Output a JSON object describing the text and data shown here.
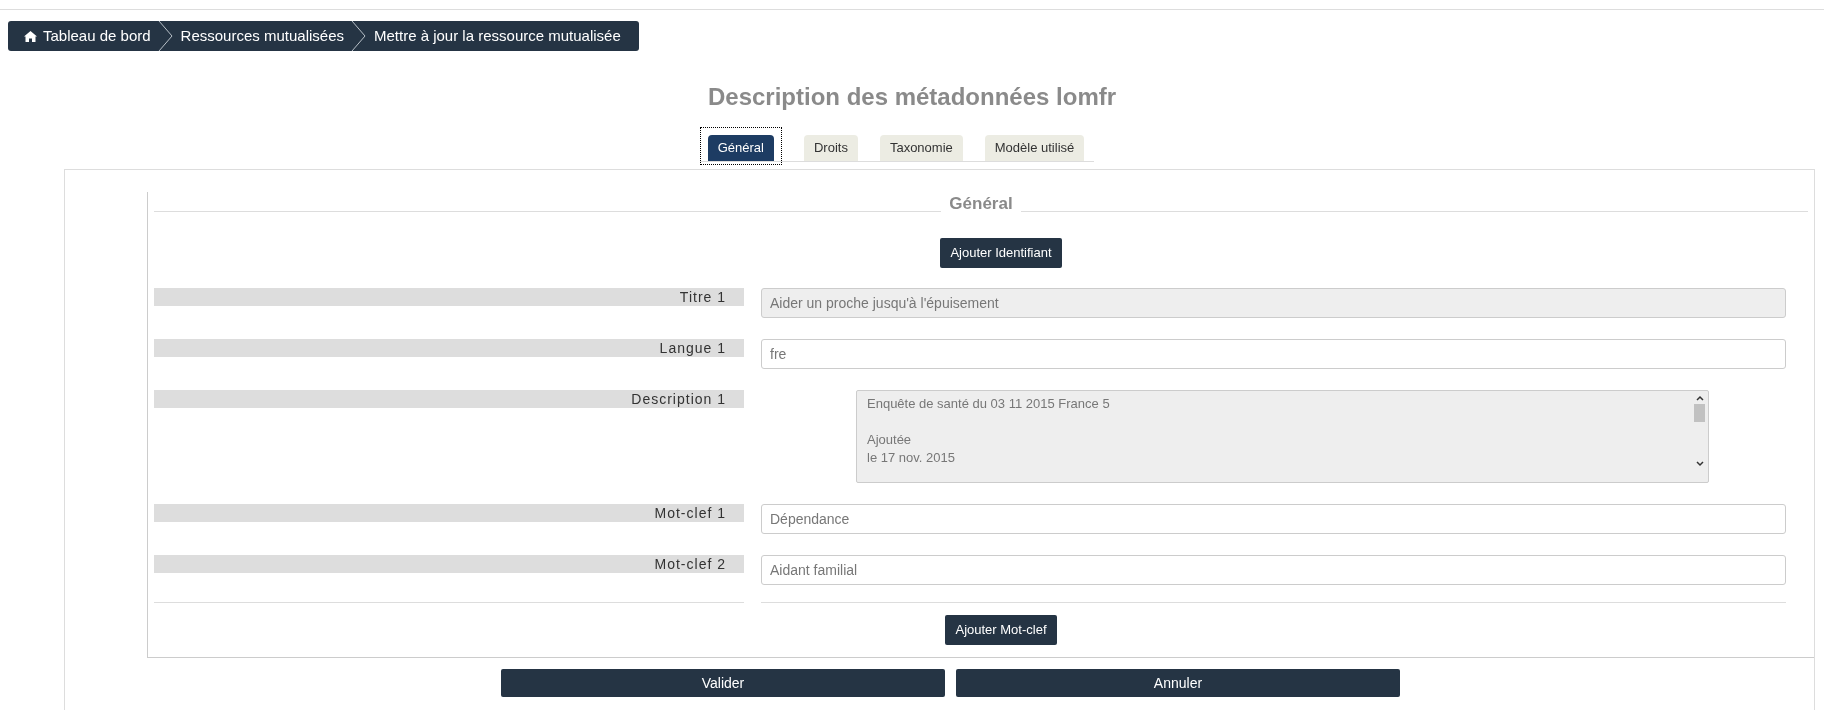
{
  "breadcrumb": [
    {
      "label": "Tableau de bord",
      "home": true
    },
    {
      "label": "Ressources mutualisées",
      "home": false
    },
    {
      "label": "Mettre à jour la ressource mutualisée",
      "home": false
    }
  ],
  "title": "Description des métadonnées lomfr",
  "tabs": [
    {
      "label": "Général",
      "selected": true
    },
    {
      "label": "Droits",
      "selected": false
    },
    {
      "label": "Taxonomie",
      "selected": false
    },
    {
      "label": "Modèle utilisé",
      "selected": false
    }
  ],
  "section": {
    "legend": "Général",
    "add_identifier": "Ajouter Identifiant",
    "fields": [
      {
        "kind": "input",
        "label": "Titre 1",
        "value": "Aider un proche jusqu'à l'épuisement",
        "disabled": true
      },
      {
        "kind": "input",
        "label": "Langue 1",
        "value": "fre",
        "disabled": false
      },
      {
        "kind": "textarea",
        "label": "Description 1",
        "value": "Enquête de santé du 03 11 2015 France 5\n\nAjoutée\nle 17 nov. 2015",
        "disabled": true
      },
      {
        "kind": "input",
        "label": "Mot-clef 1",
        "value": "Dépendance",
        "disabled": false
      },
      {
        "kind": "input",
        "label": "Mot-clef 2",
        "value": "Aidant familial",
        "disabled": false
      }
    ],
    "add_keyword": "Ajouter Mot-clef"
  },
  "buttons": [
    "Valider",
    "Annuler"
  ]
}
